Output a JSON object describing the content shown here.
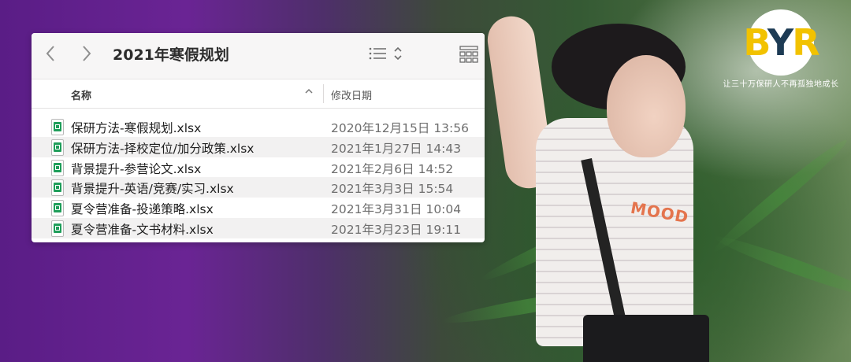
{
  "background": {
    "shirt_text": "MOOD",
    "colors": {
      "purple": "#5a1d86",
      "green": "#355a34"
    }
  },
  "logo": {
    "letters": [
      "B",
      "Y",
      "R"
    ],
    "tagline": "让三十万保研人不再孤独地成长",
    "colors": {
      "yellow": "#f2c200",
      "navy": "#1d3b54"
    }
  },
  "finder": {
    "title": "2021年寒假规划",
    "toolbar": {
      "back_icon": "chevron-left-icon",
      "forward_icon": "chevron-right-icon",
      "view_icon": "list-view-icon",
      "grid_icon": "grid-view-icon"
    },
    "columns": {
      "name": "名称",
      "date": "修改日期",
      "sort_indicator": "^"
    },
    "files": [
      {
        "name": "保研方法-寒假规划.xlsx",
        "date": "2020年12月15日 13:56"
      },
      {
        "name": "保研方法-择校定位/加分政策.xlsx",
        "date": "2021年1月27日 14:43"
      },
      {
        "name": "背景提升-参营论文.xlsx",
        "date": "2021年2月6日 14:52"
      },
      {
        "name": "背景提升-英语/竞赛/实习.xlsx",
        "date": "2021年3月3日 15:54"
      },
      {
        "name": "夏令营准备-投递策略.xlsx",
        "date": "2021年3月31日 10:04"
      },
      {
        "name": "夏令营准备-文书材料.xlsx",
        "date": "2021年3月23日 19:11"
      }
    ]
  }
}
